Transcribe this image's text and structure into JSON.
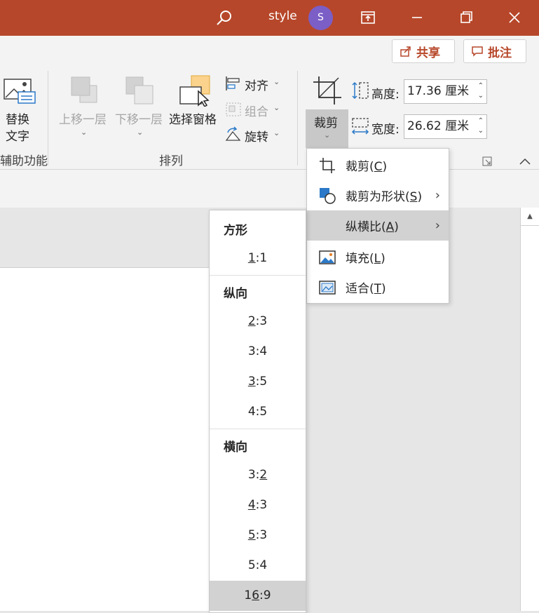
{
  "titlebar": {
    "user_name": "style",
    "avatar_initial": "S"
  },
  "ribbon": {
    "share_label": "共享",
    "comment_label": "批注",
    "alt_text_line1": "替换",
    "alt_text_line2": "文字",
    "accessibility_group": "辅助功能",
    "bring_forward": "上移一层",
    "send_backward": "下移一层",
    "selection_pane": "选择窗格",
    "align": "对齐",
    "group": "组合",
    "rotate": "旋转",
    "arrange_group": "排列",
    "crop": "裁剪",
    "height_label": "高度:",
    "height_value": "17.36 厘米",
    "width_label": "宽度:",
    "width_value": "26.62 厘米"
  },
  "crop_menu": {
    "items": [
      {
        "label": "裁剪",
        "key": "C",
        "icon": "crop-icon"
      },
      {
        "label": "裁剪为形状",
        "key": "S",
        "icon": "shape-icon",
        "submenu": true
      },
      {
        "label": "纵横比",
        "key": "A",
        "icon": "",
        "submenu": true,
        "highlighted": true
      },
      {
        "label": "填充",
        "key": "L",
        "icon": "fill-picture-icon"
      },
      {
        "label": "适合",
        "key": "T",
        "icon": "fit-picture-icon"
      }
    ]
  },
  "aspect_menu": {
    "square_header": "方形",
    "square": [
      "1:1"
    ],
    "portrait_header": "纵向",
    "portrait": [
      "2:3",
      "3:4",
      "3:5",
      "4:5"
    ],
    "landscape_header": "横向",
    "landscape": [
      "3:2",
      "4:3",
      "5:3",
      "5:4",
      "16:9"
    ],
    "selected": "16:9"
  }
}
